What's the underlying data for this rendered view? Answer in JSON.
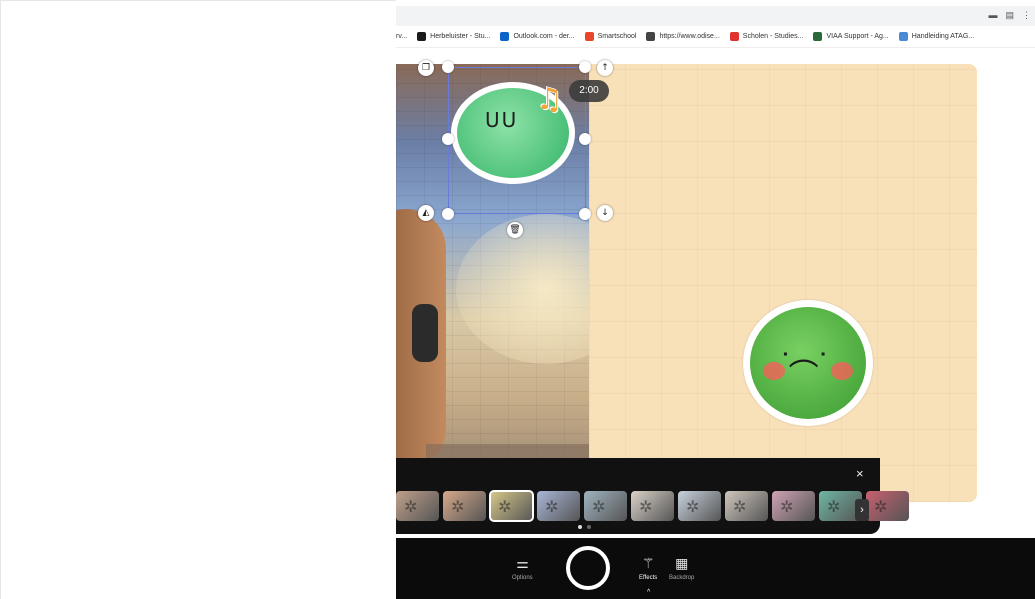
{
  "browser": {
    "bookmarks": [
      {
        "label": "rv...",
        "color": "#ffffff"
      },
      {
        "label": "Herbeluister - Stu...",
        "color": "#1b1b1b"
      },
      {
        "label": "Outlook.com - der...",
        "color": "#0a64c9"
      },
      {
        "label": "Smartschool",
        "color": "#e8472c"
      },
      {
        "label": "https://www.odise...",
        "color": "#444444"
      },
      {
        "label": "Scholen - Studies...",
        "color": "#e0322e"
      },
      {
        "label": "VIAA Support - Ag...",
        "color": "#2a6a3a"
      },
      {
        "label": "Handleiding ATAG...",
        "color": "#4a8ad4"
      }
    ]
  },
  "canvas": {
    "sticker_selected": {
      "text": "UU",
      "duration": "2:00"
    },
    "sticker_second": {
      "text": "ᐧ︵ᐧ"
    }
  },
  "filter_tray": {
    "close_label": "×",
    "next_label": "›",
    "filters": [
      {
        "color": "#bfa08a",
        "selected": false
      },
      {
        "color": "#d7a98a",
        "selected": false
      },
      {
        "color": "#d8c98a",
        "selected": true
      },
      {
        "color": "#a9b6d8",
        "selected": false
      },
      {
        "color": "#9fb4c0",
        "selected": false
      },
      {
        "color": "#d9d2c8",
        "selected": false
      },
      {
        "color": "#c8d2dc",
        "selected": false
      },
      {
        "color": "#cfc7bd",
        "selected": false
      },
      {
        "color": "#cfa3b4",
        "selected": false
      },
      {
        "color": "#6fb6a4",
        "selected": false
      },
      {
        "color": "#c86070",
        "selected": false
      }
    ],
    "page_dots": 2,
    "active_dot": 0
  },
  "toolbar": {
    "options_label": "Options",
    "effects_label": "Effects",
    "backdrop_label": "Backdrop",
    "active_tab": "effects"
  }
}
